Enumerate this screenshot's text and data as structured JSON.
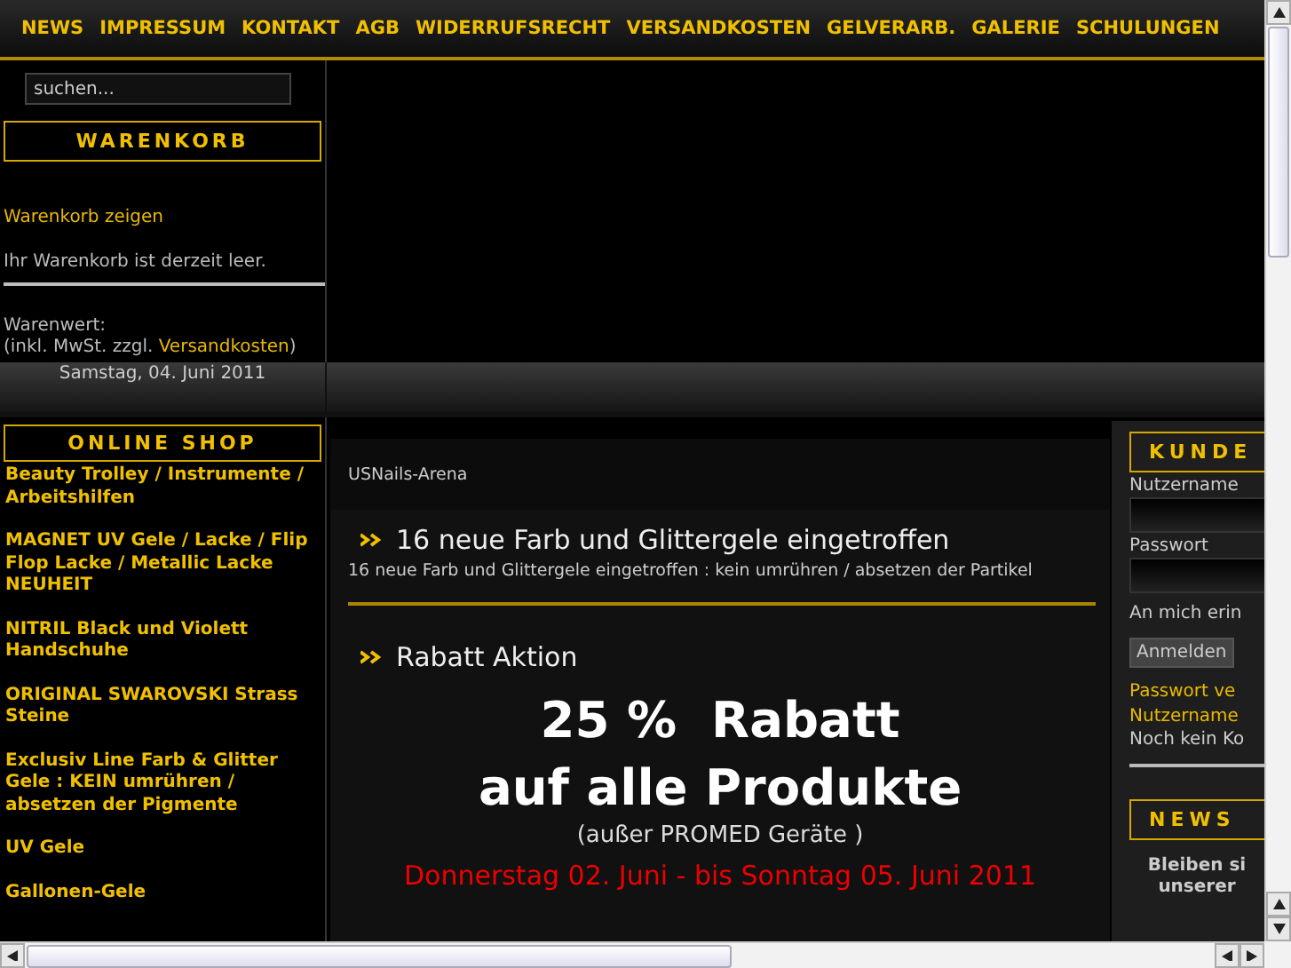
{
  "nav": [
    "NEWS",
    "IMPRESSUM",
    "KONTAKT",
    "AGB",
    "WIDERRUFSRECHT",
    "VERSANDKOSTEN",
    "GELVERARB.",
    "GALERIE",
    "SCHULUNGEN"
  ],
  "search": {
    "placeholder": "suchen..."
  },
  "cart": {
    "title": "WARENKORB",
    "link": "Warenkorb zeigen",
    "status": "Ihr Warenkorb ist derzeit leer.",
    "value_label": "Warenwert:",
    "tax_note_prefix": "(inkl. MwSt. zzgl. ",
    "tax_note_link": "Versandkosten",
    "tax_note_suffix": ")"
  },
  "date": "Samstag, 04. Juni 2011",
  "shop": {
    "title": "ONLINE SHOP",
    "categories": [
      "Beauty Trolley / Instrumente / Arbeitshilfen",
      "MAGNET UV Gele / Lacke / Flip Flop Lacke / Metallic Lacke NEUHEIT",
      "NITRIL Black und Violett Handschuhe",
      "ORIGINAL SWAROVSKI Strass Steine",
      "Exclusiv Line Farb & Glitter Gele : KEIN umrühren / absetzen der Pigmente",
      "UV Gele",
      "Gallonen-Gele"
    ]
  },
  "content": {
    "site_name": "USNails-Arena",
    "articles": [
      {
        "title": "16 neue Farb und Glittergele eingetroffen",
        "summary": "16 neue Farb und Glittergele eingetroffen : kein umrühren / absetzen der Partikel"
      },
      {
        "title": "Rabatt Aktion"
      }
    ],
    "promo": {
      "headline": [
        "25 %  Rabatt",
        "auf alle Produkte"
      ],
      "note": "(außer PROMED Geräte )",
      "dates": "Donnerstag 02. Juni - bis Sonntag 05. Juni 2011"
    }
  },
  "login": {
    "title": "KUNDE",
    "username_label": "Nutzername",
    "password_label": "Passwort",
    "remember_label": "An mich erin",
    "submit": "Anmelden",
    "links": [
      "Passwort ve",
      "Nutzername"
    ],
    "register_note": "Noch kein Ko"
  },
  "newsletter": {
    "title": "NEWS",
    "text": [
      "Bleiben si",
      "unserer"
    ]
  }
}
